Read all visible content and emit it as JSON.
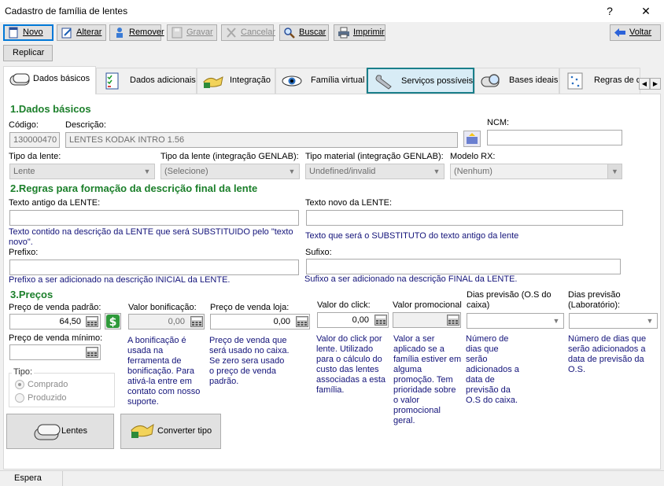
{
  "window": {
    "title": "Cadastro de família de lentes",
    "help": "?",
    "close": "✕"
  },
  "toolbar": {
    "novo": "Novo",
    "alterar": "Alterar",
    "remover": "Remover",
    "gravar": "Gravar",
    "cancelar": "Cancelar",
    "buscar": "Buscar",
    "imprimir": "Imprimir",
    "voltar": "Voltar",
    "replicar": "Replicar"
  },
  "tabs": [
    "Dados básicos",
    "Dados adicionais",
    "Integração",
    "Família virtual",
    "Serviços possíveis",
    "Bases ideais",
    "Regras de c"
  ],
  "sec1": {
    "title": "1.Dados básicos",
    "codigo_label": "Código:",
    "codigo": "130000470",
    "descricao_label": "Descrição:",
    "descricao": "LENTES KODAK INTRO 1.56",
    "ncm_label": "NCM:",
    "ncm": "",
    "tipo_lente_label": "Tipo da lente:",
    "tipo_lente": "Lente",
    "tipo_genlab_label": "Tipo da lente (integração GENLAB):",
    "tipo_genlab": "(Selecione)",
    "material_label": "Tipo material (integração GENLAB):",
    "material": "Undefined/invalid",
    "modelo_label": "Modelo RX:",
    "modelo": "(Nenhum)"
  },
  "sec2": {
    "title": "2.Regras para formação da descrição final da lente",
    "antigo_label": "Texto antigo da LENTE:",
    "antigo_help": "Texto contido na descrição da LENTE que será SUBSTITUIDO pelo \"texto novo\".",
    "novo_label": "Texto novo da LENTE:",
    "novo_help": "Texto que será o SUBSTITUTO do texto antigo da lente",
    "prefixo_label": "Prefixo:",
    "prefixo_help": "Prefixo a ser adicionado na descrição INICIAL da LENTE.",
    "sufixo_label": "Sufixo:",
    "sufixo_help": "Sufixo a ser adicionado na descrição FINAL da LENTE."
  },
  "sec3": {
    "title": "3.Preços",
    "padrao_label": "Preço de venda padrão:",
    "padrao": "64,50",
    "minimo_label": "Preço de venda mínimo:",
    "minimo": "",
    "bonif_label": "Valor bonificação:",
    "bonif": "0,00",
    "bonif_help": "A bonificação é usada na ferramenta de bonificação. Para ativá-la entre em contato com nosso suporte.",
    "loja_label": "Preço de venda loja:",
    "loja": "0,00",
    "loja_help": "Preço de venda que será usado no caixa. Se zero sera usado o preço de venda padrão.",
    "click_label": "Valor do click:",
    "click": "0,00",
    "click_help": "Valor do click por lente. Utilizado para o cálculo do custo das lentes associadas a esta família.",
    "promo_label": "Valor promocional",
    "promo": "",
    "promo_help": "Valor a ser aplicado se a família estiver em alguma promoção. Tem prioridade sobre o valor promocional geral.",
    "dias_caixa_label": "Dias previsão (O.S do caixa)",
    "dias_caixa_help": "Número de dias que serão adicionados a data de previsão da O.S do caixa.",
    "dias_lab_label": "Dias previsão (Laboratório):",
    "dias_lab_help": "Número de dias que serão adicionados a data de previsão da O.S.",
    "tipo_label": "Tipo:",
    "comprado": "Comprado",
    "produzido": "Produzido"
  },
  "buttons": {
    "lentes": "Lentes",
    "converter": "Converter tipo"
  },
  "status": {
    "text": "Espera"
  }
}
